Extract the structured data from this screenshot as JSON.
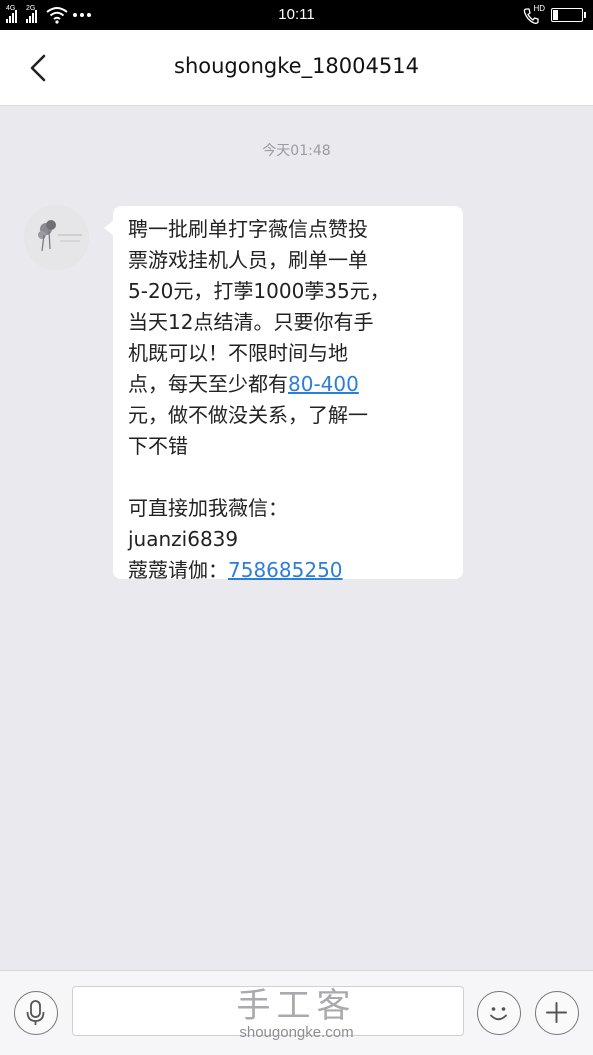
{
  "status_bar": {
    "network_1": "4G",
    "network_2": "2G",
    "time": "10:11",
    "hd_label": "HD"
  },
  "header": {
    "title": "shougongke_18004514"
  },
  "conversation": {
    "timestamp": "今天01:48",
    "message": {
      "lines": [
        "聘一批刷单打字薇信点赞投",
        "票游戏挂机人员，刷单一单",
        "5-20元，打荸1000荸35元，",
        "当天12点结清。只要你有手",
        "机既可以！不限时间与地",
        "点，每天至少都有",
        "元，做不做没关系，了解一",
        "下不错",
        "可直接加我薇信：",
        "juanzi6839",
        "蔻蔻请伽："
      ],
      "link_range": "80-400",
      "link_qq": "758685250"
    }
  },
  "watermark": {
    "title": "手工客",
    "site": "shougongke.com"
  },
  "colors": {
    "background": "#e9e9ee",
    "link": "#2b7fd6",
    "bubble": "#ffffff"
  }
}
